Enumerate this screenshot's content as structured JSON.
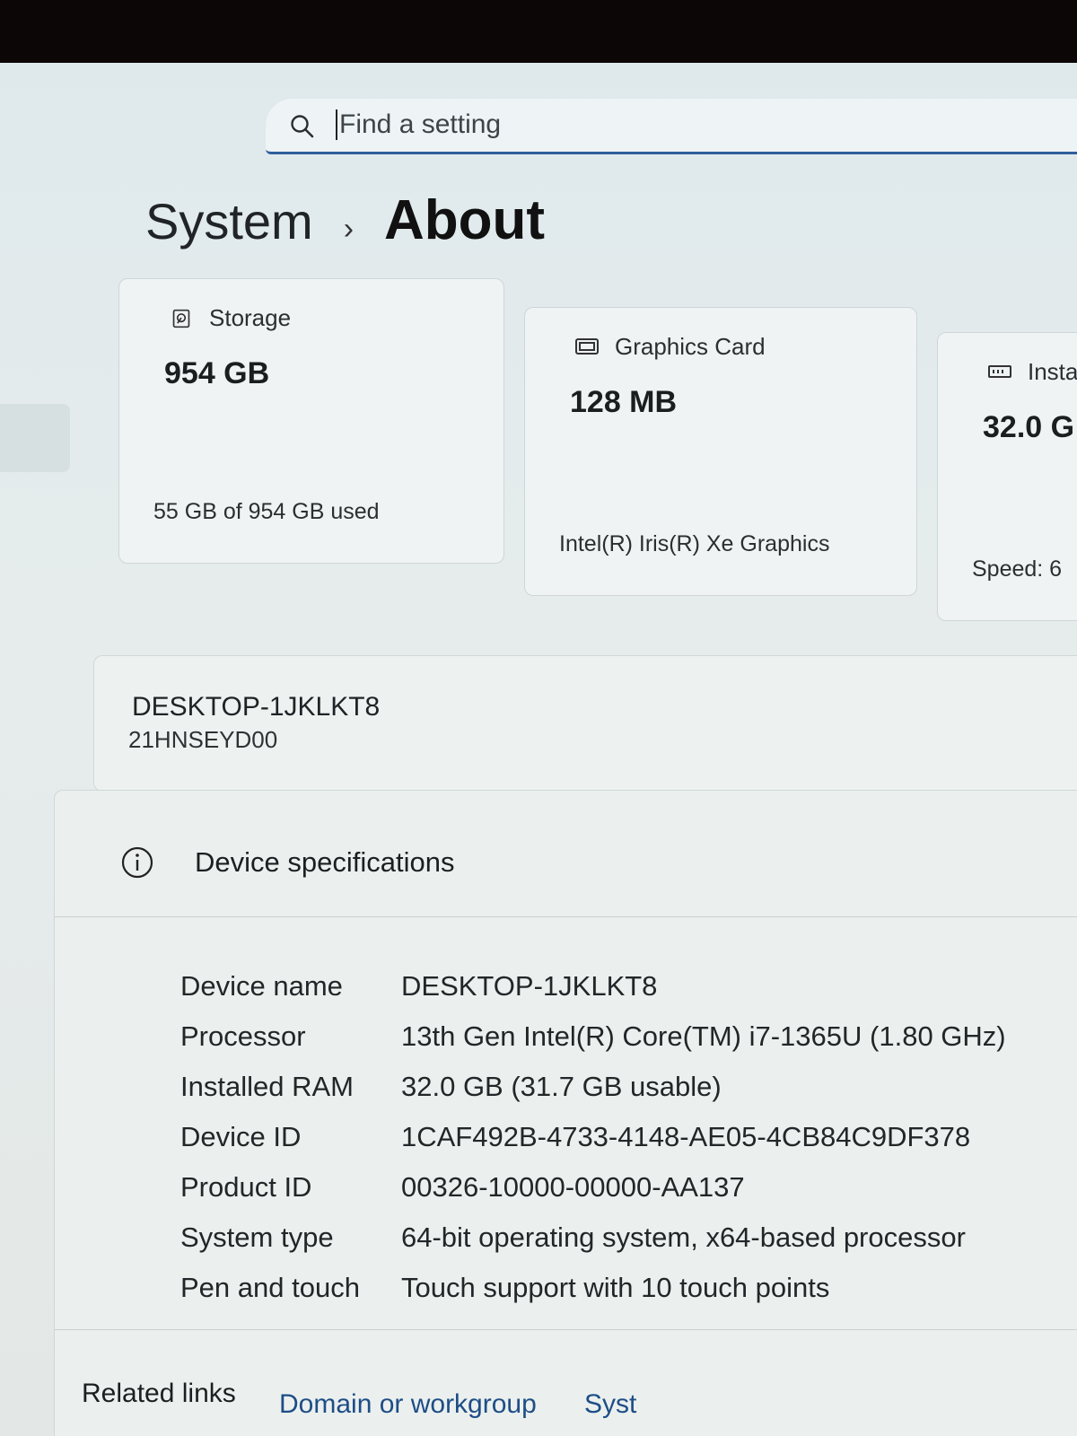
{
  "search": {
    "placeholder": "Find a setting"
  },
  "breadcrumb": {
    "parent": "System",
    "current": "About"
  },
  "cards": [
    {
      "icon": "storage-icon",
      "label": "Storage",
      "value": "954 GB",
      "sub": "55 GB of 954 GB used"
    },
    {
      "icon": "graphics-card-icon",
      "label": "Graphics Card",
      "value": "128 MB",
      "sub": "Intel(R) Iris(R) Xe Graphics"
    },
    {
      "icon": "ram-icon",
      "label": "Insta",
      "value": "32.0 G",
      "sub": "Speed: 6"
    }
  ],
  "device": {
    "name": "DESKTOP-1JKLKT8",
    "model": "21HNSEYD00"
  },
  "specs": {
    "title": "Device specifications",
    "rows": [
      {
        "key": "Device name",
        "value": "DESKTOP-1JKLKT8"
      },
      {
        "key": "Processor",
        "value": "13th Gen Intel(R) Core(TM) i7-1365U (1.80 GHz)"
      },
      {
        "key": "Installed RAM",
        "value": "32.0 GB (31.7 GB usable)"
      },
      {
        "key": "Device ID",
        "value": "1CAF492B-4733-4148-AE05-4CB84C9DF378"
      },
      {
        "key": "Product ID",
        "value": "00326-10000-00000-AA137"
      },
      {
        "key": "System type",
        "value": "64-bit operating system, x64-based processor"
      },
      {
        "key": "Pen and touch",
        "value": "Touch support with 10 touch points"
      }
    ]
  },
  "related": {
    "label": "Related links",
    "link1": "Domain or workgroup",
    "link2": "Syst"
  }
}
